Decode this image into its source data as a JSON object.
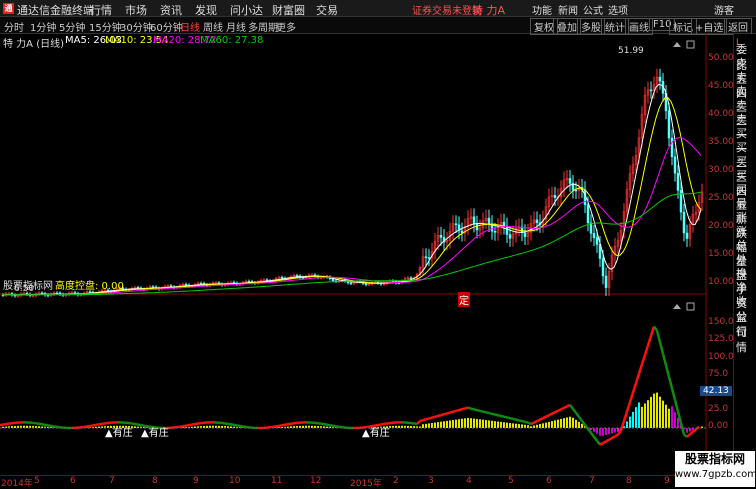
{
  "menubar": {
    "app_title": "通达信金融终端",
    "items": [
      "行情",
      "市场",
      "资讯",
      "发现",
      "问小达",
      "财富圈",
      "交易"
    ],
    "notice": "证券交易未登录",
    "stock_name": "特 力A",
    "right_items": [
      "功能",
      "新闻",
      "公式",
      "选项",
      "游客"
    ]
  },
  "toolbar": {
    "periods": [
      "分时",
      "1分钟",
      "5分钟",
      "15分钟",
      "30分钟",
      "60分钟",
      "日线",
      "周线",
      "月线",
      "多周期",
      "更多"
    ],
    "active": "日线",
    "buttons": [
      "复权",
      "叠加",
      "多股",
      "统计",
      "画线",
      "F10",
      "标记",
      "+自选",
      "返回"
    ]
  },
  "main_legend": {
    "name": "特 力A (日线)",
    "ma5": "MA5: 26.03",
    "ma10": "MA10: 23.54",
    "ma20": "MA20: 28.72",
    "ma60": "MA60: 27.38"
  },
  "price_axis": [
    "50.00",
    "45.00",
    "40.00",
    "35.00",
    "30.00",
    "25.00",
    "20.00",
    "15.00",
    "10.00"
  ],
  "high_label": "51.99",
  "low_label": "6.50",
  "ding_label": "定",
  "sub_legend": {
    "name": "股票指标网",
    "indicator": "高度控盘: 0.00"
  },
  "sub_axis": [
    "150.0",
    "125.0",
    "100.0",
    "75.0",
    "50.0",
    "25.0",
    "0.00"
  ],
  "sub_value": "42.13",
  "markers": [
    "有庄",
    "有庄",
    "有庄"
  ],
  "dates": [
    "2014年",
    "5",
    "6",
    "7",
    "8",
    "9",
    "10",
    "11",
    "12",
    "2015年",
    "2",
    "3",
    "4",
    "5",
    "6",
    "7",
    "8",
    "9",
    "10"
  ],
  "right_panel": [
    "委比",
    "卖五",
    "卖四",
    "卖三",
    "卖二",
    "卖一",
    "买一",
    "买二",
    "买三",
    "买四",
    "买五",
    "最新",
    "涨跌",
    "涨幅",
    "总量",
    "外盘",
    "换手",
    "净资",
    "收益",
    "",
    "公司",
    "行情"
  ],
  "watermark": {
    "line1": "股票指标网",
    "line2": "www.7gpzb.com"
  },
  "colors": {
    "up": "#ff3232",
    "down": "#54ffff",
    "ma5": "#ffffff",
    "ma10": "#ffff00",
    "ma20": "#ff00ff",
    "ma60": "#00cc00",
    "axis": "#cc3333"
  },
  "chart_data": {
    "type": "line",
    "title": "特 力A (日线)",
    "x": [
      "2014-05",
      "2014-06",
      "2014-07",
      "2014-08",
      "2014-09",
      "2014-10",
      "2014-11",
      "2014-12",
      "2015-01",
      "2015-02",
      "2015-03",
      "2015-04",
      "2015-05",
      "2015-06",
      "2015-07",
      "2015-08",
      "2015-09",
      "2015-10"
    ],
    "series": [
      {
        "name": "MA5",
        "values": [
          7.2,
          7.6,
          8.0,
          8.3,
          8.8,
          9.4,
          9.6,
          9.0,
          8.8,
          9.2,
          11,
          18,
          19,
          17,
          25,
          17,
          44,
          26
        ]
      },
      {
        "name": "MA60",
        "values": [
          7.0,
          7.2,
          7.5,
          7.9,
          8.4,
          8.9,
          9.3,
          9.4,
          9.3,
          9.4,
          10,
          12,
          15,
          17,
          18,
          19,
          22,
          27.4
        ]
      }
    ],
    "ylim": [
      6,
      55
    ]
  }
}
